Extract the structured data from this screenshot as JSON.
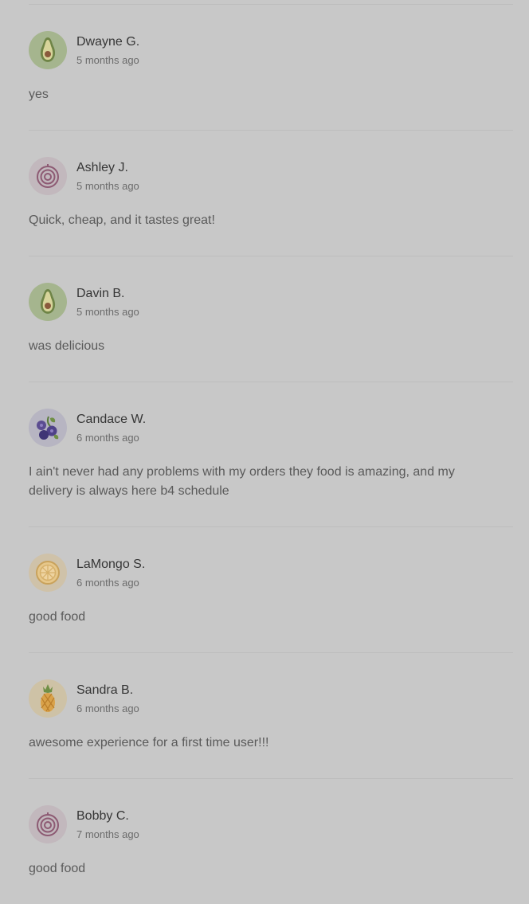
{
  "reviews": [
    {
      "name": "Dwayne G.",
      "time": "5 months ago",
      "text": "yes",
      "avatar": "avocado-icon"
    },
    {
      "name": "Ashley J.",
      "time": "5 months ago",
      "text": "Quick, cheap, and it tastes great!",
      "avatar": "onion-icon"
    },
    {
      "name": "Davin B.",
      "time": "5 months ago",
      "text": "was delicious",
      "avatar": "avocado-icon"
    },
    {
      "name": "Candace W.",
      "time": "6 months ago",
      "text": "I ain't never had any problems with my orders they food is amazing, and my delivery is always here b4 schedule",
      "avatar": "blueberry-icon"
    },
    {
      "name": "LaMongo S.",
      "time": "6 months ago",
      "text": "good food",
      "avatar": "citrus-icon"
    },
    {
      "name": "Sandra B.",
      "time": "6 months ago",
      "text": "awesome experience for a first time user!!!",
      "avatar": "pineapple-icon"
    },
    {
      "name": "Bobby C.",
      "time": "7 months ago",
      "text": "good food",
      "avatar": "onion-icon"
    }
  ],
  "colors": {
    "overlay": "#c8c8c8",
    "avocado": "#a5b58e",
    "onion": "#c2b8bd",
    "blueberry": "#b7b5c2",
    "citrus": "#cfc2a9",
    "pineapple": "#cec2a6"
  }
}
